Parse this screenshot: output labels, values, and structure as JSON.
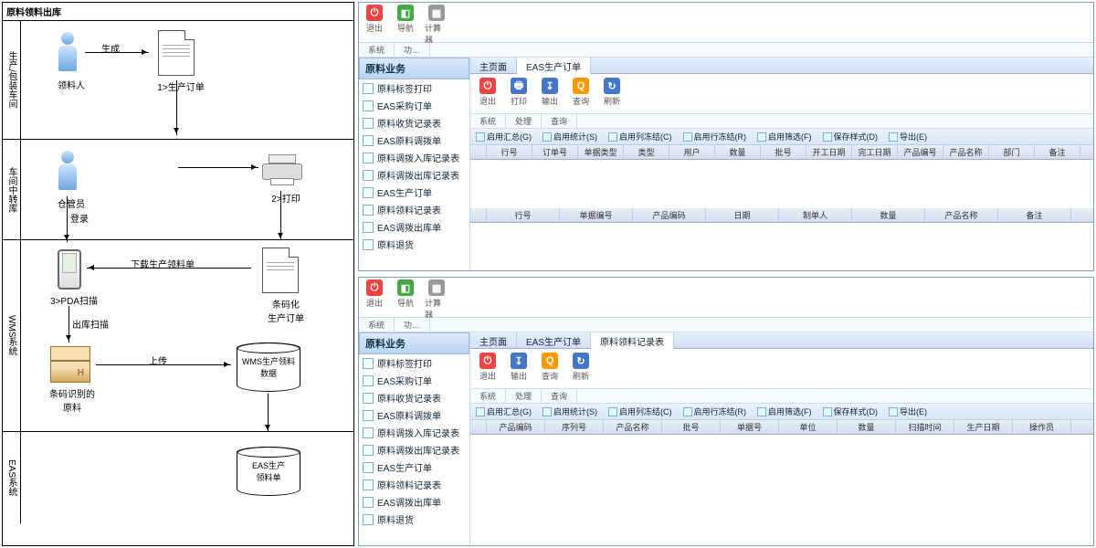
{
  "flowchart": {
    "title": "原料领料出库",
    "lanes": [
      "生产/包装车间",
      "车间中转库",
      "WMS系统",
      "EAS系统"
    ],
    "nodes": {
      "person1": "领料人",
      "doc1": "1>生产订单",
      "person2": "仓管员",
      "printer": "2>打印",
      "pda": "3>PDA扫描",
      "doc2": "条码化\n生产订单",
      "box": "条码识别的\n原料",
      "db1": "WMS生产领料\n数据",
      "db2": "EAS生产\n领料单",
      "arrow_gen": "生成",
      "arrow_login": "登录",
      "arrow_download": "下载生产领料单",
      "arrow_scan": "出库扫描",
      "arrow_upload": "上传"
    }
  },
  "sidebar": {
    "title": "原料业务",
    "items": [
      "原料标签打印",
      "EAS采购订单",
      "原料收货记录表",
      "EAS原料调拨单",
      "原料调拨入库记录表",
      "原料调拨出库记录表",
      "EAS生产订单",
      "原料领料记录表",
      "EAS调拨出库单",
      "原料退货"
    ]
  },
  "topToolbar": {
    "exit": "退出",
    "nav": "导航",
    "calc": "计算器"
  },
  "subTabs": {
    "sys": "系统",
    "func": "功…"
  },
  "app1": {
    "tabs": [
      "主页面",
      "EAS生产订单"
    ],
    "activeTab": 1,
    "toolbar": {
      "exit": "退出",
      "print": "打印",
      "export": "输出",
      "query": "查询",
      "refresh": "刷新"
    },
    "tb2Tabs": {
      "sys": "系统",
      "proc": "处理",
      "query": "查询"
    },
    "filters": [
      "启用汇总(G)",
      "启用统计(S)",
      "启用列冻结(C)",
      "启用行冻结(R)",
      "启用筛选(F)",
      "保存样式(D)",
      "导出(E)"
    ],
    "grid1_cols": [
      "行号",
      "订单号",
      "单据类型",
      "类型",
      "用户",
      "数量",
      "批号",
      "开工日期",
      "完工日期",
      "产品编号",
      "产品名称",
      "部门",
      "备注"
    ],
    "grid2_cols": [
      "行号",
      "单据编号",
      "产品编码",
      "日期",
      "制单人",
      "数量",
      "产品名称",
      "备注"
    ]
  },
  "app2": {
    "tabs": [
      "主页面",
      "EAS生产订单",
      "原料领料记录表"
    ],
    "activeTab": 2,
    "toolbar": {
      "exit": "退出",
      "export": "输出",
      "query": "查询",
      "refresh": "刷新"
    },
    "grid_cols": [
      "产品编码",
      "序列号",
      "产品名称",
      "批号",
      "单据号",
      "单位",
      "数量",
      "扫描时间",
      "生产日期",
      "操作员"
    ]
  }
}
